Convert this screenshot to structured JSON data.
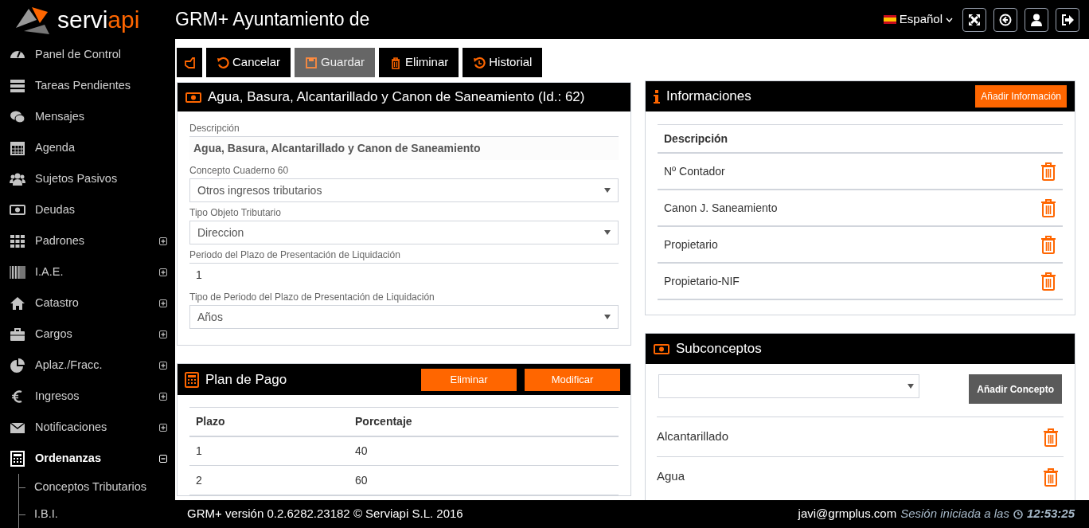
{
  "logo": {
    "text": "servi",
    "accent": "api"
  },
  "sidebar": {
    "items": [
      {
        "label": "Panel de Control",
        "selected": false
      },
      {
        "label": "Tareas Pendientes",
        "selected": false
      },
      {
        "label": "Mensajes",
        "selected": false
      },
      {
        "label": "Agenda",
        "selected": false
      },
      {
        "label": "Sujetos Pasivos",
        "selected": false
      },
      {
        "label": "Deudas",
        "selected": false
      },
      {
        "label": "Padrones",
        "selected": false,
        "expanded": false
      },
      {
        "label": "I.A.E.",
        "selected": false,
        "expanded": false
      },
      {
        "label": "Catastro",
        "selected": false,
        "expanded": false
      },
      {
        "label": "Cargos",
        "selected": false,
        "expanded": false
      },
      {
        "label": "Aplaz./Fracc.",
        "selected": false,
        "expanded": false
      },
      {
        "label": "Ingresos",
        "selected": false,
        "expanded": false
      },
      {
        "label": "Notificaciones",
        "selected": false,
        "expanded": false
      },
      {
        "label": "Ordenanzas",
        "selected": true,
        "expanded": true,
        "children": [
          {
            "label": "Conceptos Tributarios"
          },
          {
            "label": "I.B.I."
          }
        ]
      }
    ]
  },
  "header": {
    "title": "GRM+ Ayuntamiento de",
    "language": "Español"
  },
  "toolbar": [
    {
      "kind": "icon"
    },
    {
      "kind": "text",
      "label": "Cancelar",
      "disabled": false
    },
    {
      "kind": "text",
      "label": "Guardar",
      "disabled": true
    },
    {
      "kind": "text",
      "label": "Eliminar",
      "disabled": false
    },
    {
      "kind": "text",
      "label": "Historial",
      "disabled": false
    }
  ],
  "concept_panel": {
    "title": "Agua, Basura, Alcantarillado y Canon de Saneamiento (Id.: 62)",
    "fields": [
      {
        "kind": "readonly",
        "label": "Descripción",
        "value": "Agua, Basura, Alcantarillado y Canon de Saneamiento"
      },
      {
        "kind": "select",
        "label": "Concepto Cuaderno 60",
        "value": "Otros ingresos tributarios"
      },
      {
        "kind": "select",
        "label": "Tipo Objeto Tributario",
        "value": "Direccion"
      },
      {
        "kind": "input",
        "label": "Periodo del Plazo de Presentación de Liquidación",
        "value": "1"
      },
      {
        "kind": "select",
        "label": "Tipo de Periodo del Plazo de Presentación de Liquidación",
        "value": "Años"
      }
    ]
  },
  "payment_plan": {
    "title": "Plan de Pago",
    "buttons": [
      "Eliminar",
      "Modificar"
    ],
    "columns": [
      "Plazo",
      "Porcentaje"
    ],
    "rows": [
      [
        "1",
        "40"
      ],
      [
        "2",
        "60"
      ]
    ]
  },
  "info_panel": {
    "title": "Informaciones",
    "button": "Añadir Información",
    "column": "Descripción",
    "rows": [
      "Nº Contador",
      "Canon J. Saneamiento",
      "Propietario",
      "Propietario-NIF"
    ]
  },
  "subconcepts": {
    "title": "Subconceptos",
    "button": "Añadir Concepto",
    "rows": [
      "Alcantarillado",
      "Agua"
    ]
  },
  "footer": {
    "version": "GRM+ versión 0.2.6282.23182 © Serviapi S.L. 2016",
    "user": "javi@grmplus.com",
    "session_label": "Sesión iniciada a las",
    "time": "12:53:25"
  }
}
